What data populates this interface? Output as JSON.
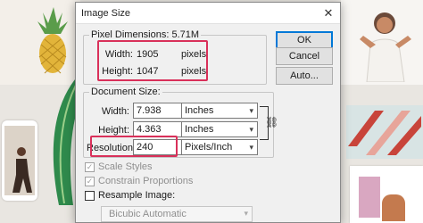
{
  "dialog": {
    "title": "Image Size",
    "close_glyph": "✕"
  },
  "pixel_dimensions": {
    "legend": "Pixel Dimensions:  5.71M",
    "width_label": "Width:",
    "width_value": "1905",
    "width_unit": "pixels",
    "height_label": "Height:",
    "height_value": "1047",
    "height_unit": "pixels"
  },
  "document_size": {
    "legend": "Document Size:",
    "width_label": "Width:",
    "width_value": "7.938",
    "width_unit": "Inches",
    "height_label": "Height:",
    "height_value": "4.363",
    "height_unit": "Inches",
    "resolution_label": "Resolution:",
    "resolution_value": "240",
    "resolution_unit": "Pixels/Inch"
  },
  "buttons": {
    "ok": "OK",
    "cancel": "Cancel",
    "auto": "Auto..."
  },
  "options": {
    "scale_styles": "Scale Styles",
    "constrain_proportions": "Constrain Proportions",
    "resample_image": "Resample Image:",
    "resample_method": "Bicubic Automatic"
  },
  "icons": {
    "close": "close-icon",
    "link": "chain-link-icon",
    "dropdown": "chevron-down-icon",
    "check": "checkmark-icon"
  },
  "colors": {
    "highlight": "#d9305a",
    "default_button_border": "#0078d7"
  }
}
